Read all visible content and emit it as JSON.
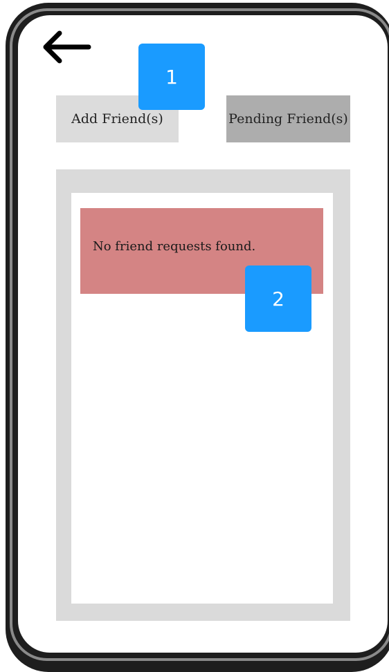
{
  "header": {
    "back_icon": "arrow-left-icon"
  },
  "tabs": {
    "add_label": "Add Friend(s)",
    "pending_label": "Pending Friend(s)"
  },
  "requests": {
    "empty_message": "No friend requests found."
  },
  "annotations": [
    {
      "label": "1"
    },
    {
      "label": "2"
    }
  ],
  "colors": {
    "add_button_bg": "#dcdcdc",
    "pending_button_bg": "#adadad",
    "alert_bg": "#d48484",
    "badge_bg": "#1a9bff",
    "panel_bg": "#dadada"
  }
}
